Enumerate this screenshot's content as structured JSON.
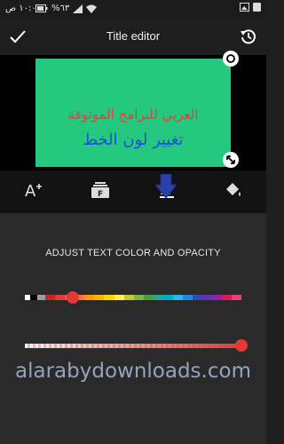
{
  "status_bar": {
    "time": "١٠:٠٠ ص",
    "battery": "%٦٣",
    "icons": [
      "battery-icon",
      "signal-icon",
      "wifi-icon",
      "gallery-icon",
      "notification-icon"
    ]
  },
  "app_bar": {
    "title": "Title editor",
    "confirm_icon": "check-icon",
    "history_icon": "history-icon"
  },
  "preview": {
    "background_color": "#25c87f",
    "line1": "العربي للبرامج الموثوقة",
    "line1_color": "#e2413a",
    "line2": "تغيير لون الخط",
    "line2_color": "#1f4fd6"
  },
  "tabs": [
    {
      "icon": "text-style-icon",
      "active": false
    },
    {
      "icon": "font-icon",
      "active": false
    },
    {
      "icon": "text-color-icon",
      "active": true
    },
    {
      "icon": "paint-bucket-icon",
      "active": false
    }
  ],
  "panel": {
    "title": "ADJUST TEXT COLOR AND OPACITY",
    "selected_color": "#e53935",
    "color_position": 0.22,
    "opacity": 1.0
  },
  "watermark": "alarabydownloads.com"
}
